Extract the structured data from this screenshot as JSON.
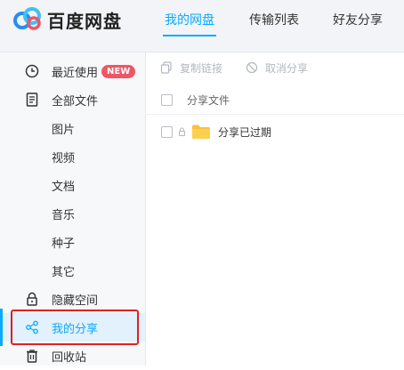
{
  "app": {
    "brand": "百度网盘",
    "accent_color": "#09AAFF",
    "logo_icon": "baidu-cloud-logo"
  },
  "nav": {
    "tabs": [
      {
        "label": "我的网盘",
        "active": true
      },
      {
        "label": "传输列表",
        "active": false
      },
      {
        "label": "好友分享",
        "active": false
      }
    ]
  },
  "sidebar": {
    "items": [
      {
        "label": "最近使用",
        "icon": "clock-icon",
        "badge": "NEW"
      },
      {
        "label": "全部文件",
        "icon": "document-icon"
      },
      {
        "label": "图片"
      },
      {
        "label": "视频"
      },
      {
        "label": "文档"
      },
      {
        "label": "音乐"
      },
      {
        "label": "种子"
      },
      {
        "label": "其它"
      },
      {
        "label": "隐藏空间",
        "icon": "lock-icon"
      },
      {
        "label": "我的分享",
        "icon": "share-icon",
        "selected": true
      },
      {
        "label": "回收站",
        "icon": "trash-icon"
      }
    ]
  },
  "toolbar": {
    "copy_link_label": "复制链接",
    "cancel_share_label": "取消分享"
  },
  "list": {
    "column_title": "分享文件",
    "rows": [
      {
        "name": "分享已过期",
        "icon": "folder-icon",
        "locked": true
      }
    ]
  }
}
